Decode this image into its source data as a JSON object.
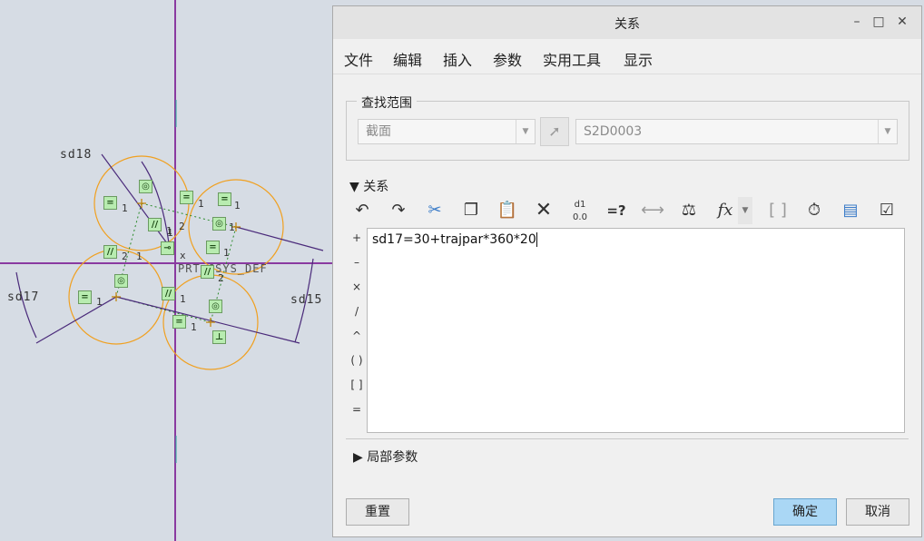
{
  "canvas": {
    "dims": [
      "sd18",
      "sd17",
      "sd15"
    ],
    "csys_label": "PRT_CSYS_DEF",
    "constraint_sub": [
      "1",
      "1",
      "2",
      "1",
      "1",
      "2",
      "1",
      "1",
      "1",
      "1",
      "2",
      "1",
      "1",
      "1",
      "x"
    ]
  },
  "dialog": {
    "title": "关系",
    "window_controls": {
      "minimize": "–",
      "maximize": "□",
      "close": "✕"
    },
    "menu": [
      "文件",
      "编辑",
      "插入",
      "参数",
      "实用工具",
      "显示"
    ],
    "search_scope": {
      "label": "查找范围",
      "scope_value": "截面",
      "object_value": "S2D0003"
    },
    "relations": {
      "label": "关系",
      "toolbar": [
        "undo-icon",
        "redo-icon",
        "cut-icon",
        "copy-icon",
        "paste-icon",
        "delete-icon",
        "switch-dimensions-icon",
        "evaluate-icon",
        "insert-parameter-icon",
        "units-icon",
        "insert-function-icon",
        "function-dropdown",
        "brackets-icon",
        "sort-relations-icon",
        "execute-icon",
        "verify-icon"
      ],
      "eval_label": "=?",
      "fx_label": "fx",
      "d1_label": "d1",
      "operators": [
        "+",
        "–",
        "×",
        "/",
        "^",
        "( )",
        "[ ]",
        "="
      ],
      "text": "sd17=30+trajpar*360*20"
    },
    "local_params_label": "局部参数",
    "buttons": {
      "reset": "重置",
      "ok": "确定",
      "cancel": "取消"
    }
  }
}
